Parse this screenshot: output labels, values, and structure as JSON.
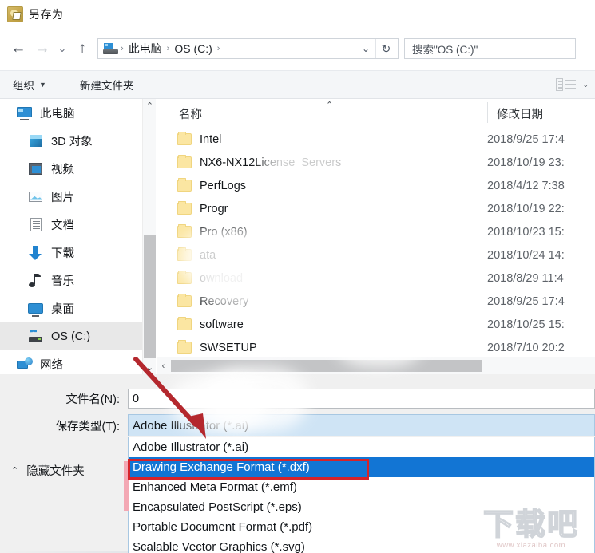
{
  "window": {
    "title": "另存为",
    "icon": "illustrator-icon"
  },
  "navigation": {
    "back_icon": "←",
    "forward_icon": "→",
    "recent_icon": "⌄",
    "up_icon": "↑",
    "address_icon": "this-pc-icon",
    "breadcrumbs": [
      "此电脑",
      "OS (C:)"
    ],
    "separator": "›",
    "dropdown_icon": "⌄",
    "refresh_icon": "↻",
    "search_placeholder": "搜索\"OS (C:)\""
  },
  "toolbar": {
    "organize_label": "组织",
    "organize_caret": "▼",
    "new_folder_label": "新建文件夹",
    "view_icon": "view-mode-icon",
    "view_caret": "⌄"
  },
  "sidebar": {
    "items": [
      {
        "label": "此电脑",
        "icon": "pc-icon",
        "level": 0,
        "selected": false
      },
      {
        "label": "3D 对象",
        "icon": "3d-objects-icon",
        "level": 1,
        "selected": false
      },
      {
        "label": "视频",
        "icon": "videos-icon",
        "level": 1,
        "selected": false
      },
      {
        "label": "图片",
        "icon": "pictures-icon",
        "level": 1,
        "selected": false
      },
      {
        "label": "文档",
        "icon": "documents-icon",
        "level": 1,
        "selected": false
      },
      {
        "label": "下载",
        "icon": "downloads-icon",
        "level": 1,
        "selected": false
      },
      {
        "label": "音乐",
        "icon": "music-icon",
        "level": 1,
        "selected": false
      },
      {
        "label": "桌面",
        "icon": "desktop-icon",
        "level": 1,
        "selected": false
      },
      {
        "label": "OS (C:)",
        "icon": "drive-icon",
        "level": 1,
        "selected": true
      },
      {
        "label": "网络",
        "icon": "network-icon",
        "level": 0,
        "selected": false
      }
    ],
    "scroll_up_icon": "⌃",
    "scroll_down_icon": "⌄"
  },
  "file_list": {
    "columns": {
      "name": "名称",
      "date": "修改日期"
    },
    "sort_caret": "⌃",
    "rows": [
      {
        "name": "Intel",
        "date": "2018/9/25 17:4"
      },
      {
        "name": "NX6-NX12License_Servers",
        "date": "2018/10/19 23:"
      },
      {
        "name": "PerfLogs",
        "date": "2018/4/12 7:38"
      },
      {
        "name": "Progr",
        "date": "2018/10/19 22:"
      },
      {
        "name": "Pro                 (x86)",
        "date": "2018/10/23 15:"
      },
      {
        "name": "             ata",
        "date": "2018/10/24 14:"
      },
      {
        "name": "        ownload",
        "date": "2018/8/29 11:4"
      },
      {
        "name": "Recovery",
        "date": "2018/9/25 17:4"
      },
      {
        "name": "software",
        "date": "2018/10/25 15:"
      },
      {
        "name": "SWSETUP",
        "date": "2018/7/10 20:2"
      }
    ],
    "hscroll_left_icon": "‹"
  },
  "form": {
    "filename_label": "文件名(N):",
    "filename_value": "0",
    "filetype_label": "保存类型(T):",
    "filetype_value": "Adobe Illustrator (*.ai)",
    "hidden_folders_label": "隐藏文件夹",
    "hidden_folders_caret": "⌃"
  },
  "dropdown": {
    "options": [
      {
        "label": "Adobe Illustrator (*.ai)",
        "selected": false
      },
      {
        "label": "Drawing Exchange Format (*.dxf)",
        "selected": true
      },
      {
        "label": "Enhanced Meta Format (*.emf)",
        "selected": false
      },
      {
        "label": "Encapsulated PostScript (*.eps)",
        "selected": false
      },
      {
        "label": "Portable Document Format (*.pdf)",
        "selected": false
      },
      {
        "label": "Scalable Vector Graphics (*.svg)",
        "selected": false
      }
    ]
  },
  "annotations": {
    "arrow_color": "#b4282e",
    "highlight_box_color": "#d6232a",
    "selection_blue": "#1275d4"
  },
  "watermark": {
    "text": "下载吧",
    "url": "www.xiazaiba.com"
  }
}
